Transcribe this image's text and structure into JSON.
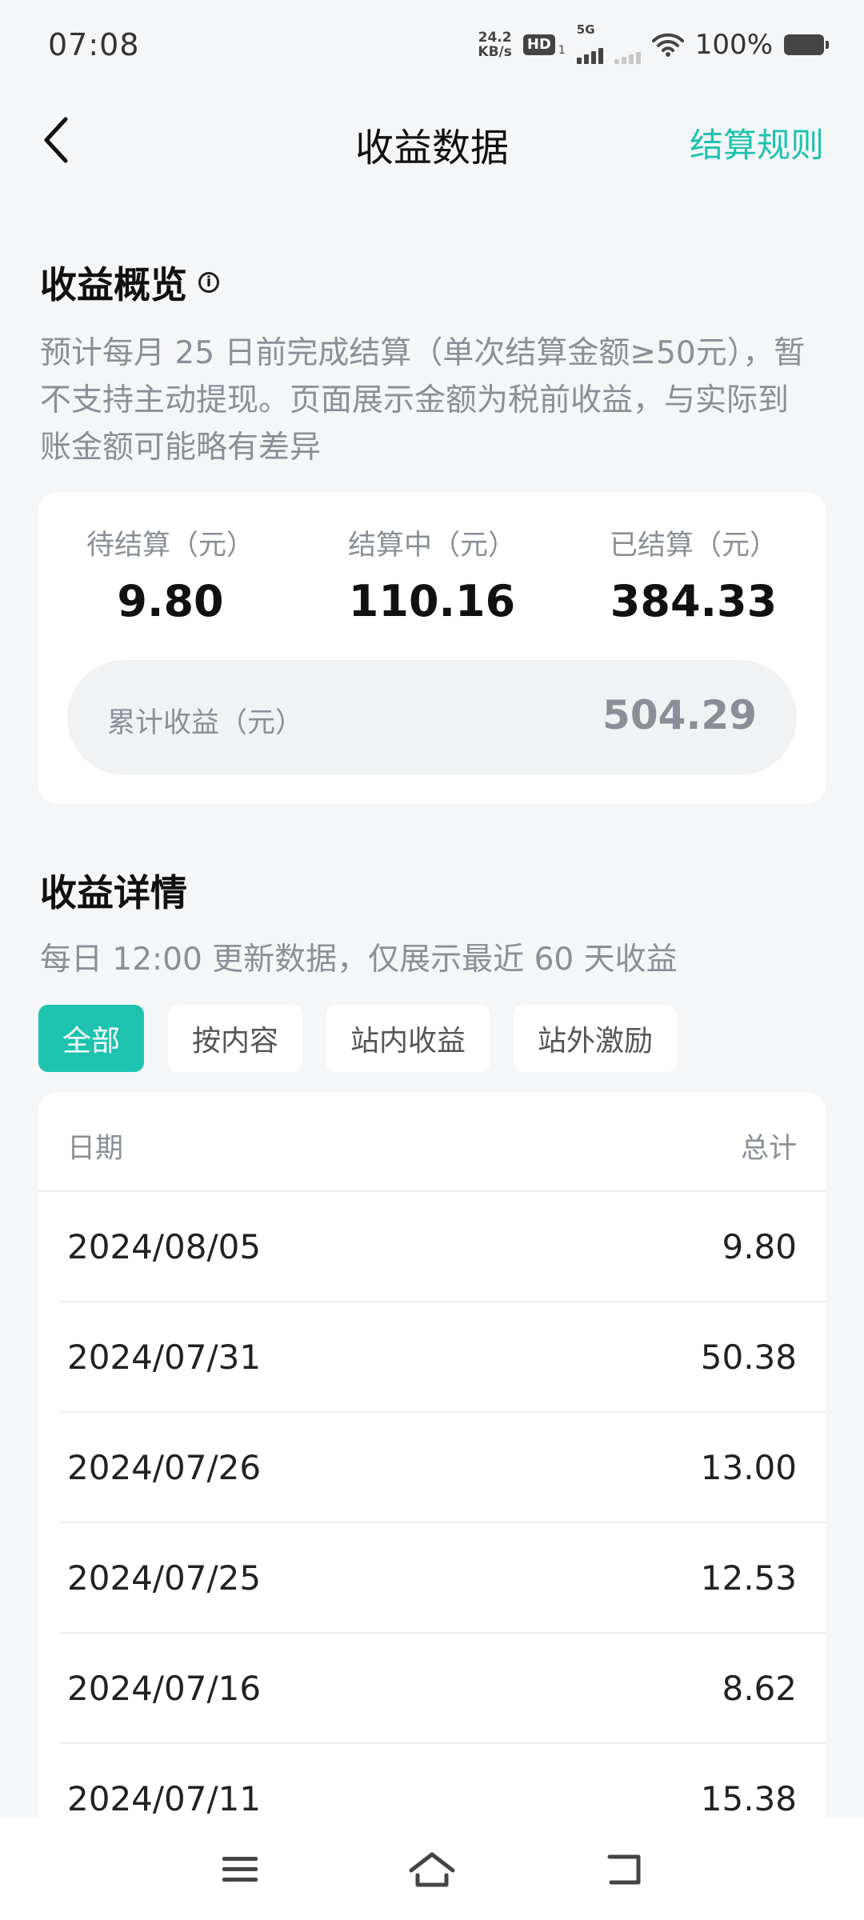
{
  "status_bar": {
    "time": "07:08",
    "net_speed_value": "24.2",
    "net_speed_unit": "KB/s",
    "hd_label": "HD",
    "hd_sub": "1",
    "network_type": "5G",
    "battery": "100%"
  },
  "header": {
    "title": "收益数据",
    "rules_link": "结算规则"
  },
  "overview": {
    "title": "收益概览",
    "description": "预计每月 25 日前完成结算（单次结算金额≥50元），暂不支持主动提现。页面展示金额为税前收益，与实际到账金额可能略有差异",
    "stats": [
      {
        "label": "待结算（元）",
        "value": "9.80"
      },
      {
        "label": "结算中（元）",
        "value": "110.16"
      },
      {
        "label": "已结算（元）",
        "value": "384.33"
      }
    ],
    "total_label": "累计收益（元）",
    "total_value": "504.29"
  },
  "details": {
    "title": "收益详情",
    "description": "每日 12:00 更新数据，仅展示最近 60 天收益",
    "tabs": [
      {
        "label": "全部",
        "active": true
      },
      {
        "label": "按内容",
        "active": false
      },
      {
        "label": "站内收益",
        "active": false
      },
      {
        "label": "站外激励",
        "active": false
      }
    ],
    "table": {
      "col_date": "日期",
      "col_total": "总计",
      "rows": [
        {
          "date": "2024/08/05",
          "amount": "9.80"
        },
        {
          "date": "2024/07/31",
          "amount": "50.38"
        },
        {
          "date": "2024/07/26",
          "amount": "13.00"
        },
        {
          "date": "2024/07/25",
          "amount": "12.53"
        },
        {
          "date": "2024/07/16",
          "amount": "8.62"
        },
        {
          "date": "2024/07/11",
          "amount": "15.38"
        }
      ]
    }
  },
  "colors": {
    "accent": "#1ec3b0",
    "background": "#f5f6f8",
    "muted_text": "#8a8f97"
  },
  "icons": {
    "back": "chevron-left-icon",
    "info": "info-icon",
    "nav_menu": "menu-icon",
    "nav_home": "home-icon",
    "nav_back": "return-icon"
  }
}
